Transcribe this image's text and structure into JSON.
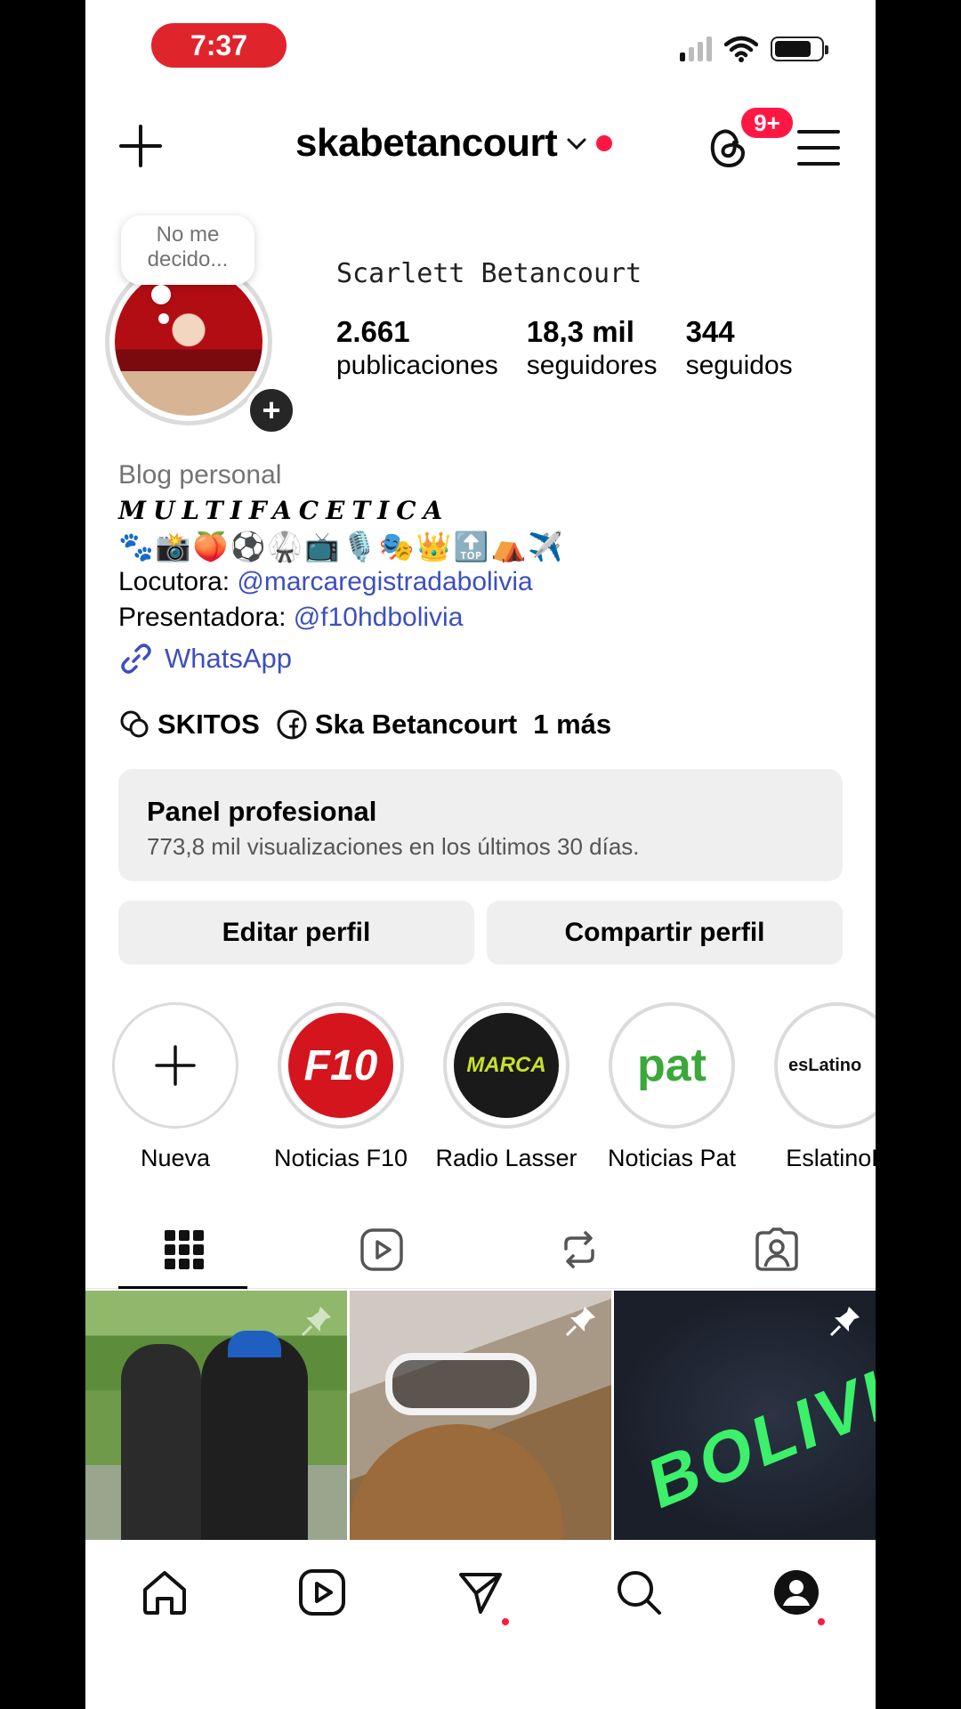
{
  "status": {
    "time": "7:37"
  },
  "header": {
    "username": "skabetancourt",
    "threads_badge": "9+"
  },
  "profile": {
    "note": "No me decido...",
    "display_name": "Scarlett Betancourt",
    "stats": [
      {
        "value": "2.661",
        "label": "publicaciones"
      },
      {
        "value": "18,3 mil",
        "label": "seguidores"
      },
      {
        "value": "344",
        "label": "seguidos"
      }
    ]
  },
  "bio": {
    "category": "Blog personal",
    "styled_line": "MULTIFACETICA",
    "emojis": "🐾📸🍑⚽🥋📺🎙️🎭👑🔝⛺✈️",
    "line1_prefix": "Locutora: ",
    "line1_mention": "@marcaregistradabolivia",
    "line2_prefix": "Presentadora: ",
    "line2_mention": "@f10hdbolivia",
    "link": "WhatsApp"
  },
  "social": {
    "threads": "SKITOS",
    "facebook": "Ska Betancourt",
    "more": "1 más"
  },
  "panel": {
    "title": "Panel profesional",
    "subtitle": "773,8 mil visualizaciones en los últimos 30 días."
  },
  "actions": {
    "edit": "Editar perfil",
    "share": "Compartir perfil"
  },
  "highlights": [
    {
      "label": "Nueva"
    },
    {
      "label": "Noticias F10",
      "art": "F10"
    },
    {
      "label": "Radio Lasser",
      "art": "MARCA"
    },
    {
      "label": "Noticias Pat",
      "art": "pat"
    },
    {
      "label": "EslatinoR",
      "art": "esLatino"
    }
  ],
  "posts": [
    {
      "overlay": ""
    },
    {
      "overlay": ""
    },
    {
      "overlay": "BOLIVIA"
    }
  ],
  "colors": {
    "accent_red": "#ff1744",
    "link_blue": "#3d4fbf"
  }
}
